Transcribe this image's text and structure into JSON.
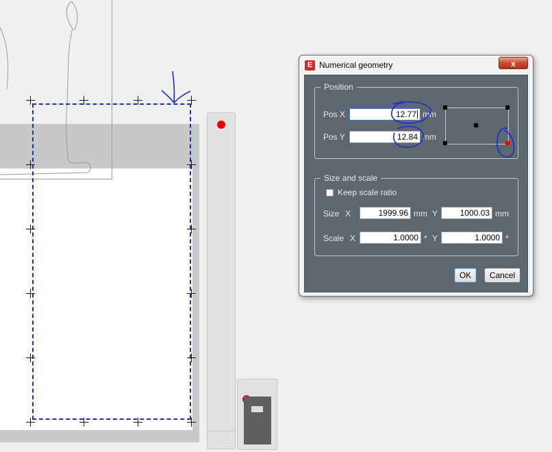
{
  "dialog": {
    "title": "Numerical geometry",
    "app_icon_letter": "E",
    "close_glyph": "x",
    "position": {
      "legend": "Position",
      "pos_x_label": "Pos X",
      "pos_x_value": "12.77",
      "pos_x_unit": "mm",
      "pos_y_label": "Pos Y",
      "pos_y_value": "12.84",
      "pos_y_unit": "mm",
      "reference_point": "bottom-right"
    },
    "size_scale": {
      "legend": "Size and scale",
      "keep_ratio_label": "Keep scale ratio",
      "keep_ratio_checked": false,
      "size_label": "Size",
      "size_x_label": "X",
      "size_x_value": "1999.96",
      "size_x_unit": "mm",
      "size_y_label": "Y",
      "size_y_value": "1000.03",
      "size_y_unit": "mm",
      "scale_label": "Scale",
      "scale_x_label": "X",
      "scale_x_value": "1.0000",
      "scale_x_unit": "*",
      "scale_y_label": "Y",
      "scale_y_value": "1.0000",
      "scale_y_unit": "*"
    },
    "ok_label": "OK",
    "cancel_label": "Cancel"
  },
  "colors": {
    "selection": "#1a2fcc",
    "annotation": "#1a2fcc",
    "dialog_client": "#5d6770",
    "status_dot": "#ee0000"
  }
}
